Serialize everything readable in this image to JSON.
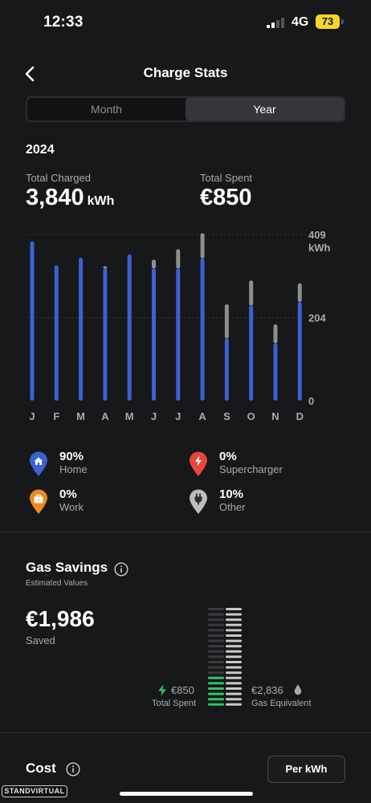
{
  "status_bar": {
    "time": "12:33",
    "network": "4G",
    "battery": "73"
  },
  "header": {
    "title": "Charge Stats"
  },
  "tabs": [
    {
      "label": "Month",
      "active": false
    },
    {
      "label": "Year",
      "active": true
    }
  ],
  "summary": {
    "year": "2024",
    "total_charged_label": "Total Charged",
    "total_charged_value": "3,840",
    "total_charged_unit": "kWh",
    "total_spent_label": "Total Spent",
    "total_spent_value": "€850"
  },
  "chart_data": {
    "type": "bar",
    "stacked": true,
    "categories": [
      "J",
      "F",
      "M",
      "A",
      "M",
      "J",
      "J",
      "A",
      "S",
      "O",
      "N",
      "D"
    ],
    "series": [
      {
        "name": "Home",
        "color": "#3a62d6",
        "values": [
          392,
          333,
          352,
          325,
          360,
          325,
          325,
          350,
          153,
          234,
          141,
          243
        ]
      },
      {
        "name": "Other",
        "color": "#8d8e90",
        "values": [
          0,
          0,
          0,
          6,
          0,
          22,
          48,
          62,
          84,
          62,
          47,
          46
        ]
      }
    ],
    "y_ticks": [
      "0",
      "204",
      "409"
    ],
    "y_unit": "kWh",
    "ylim": [
      0,
      409
    ],
    "grid": true
  },
  "legend": [
    {
      "pct": "90%",
      "name": "Home",
      "color": "#3a62d6",
      "icon": "home-icon"
    },
    {
      "pct": "0%",
      "name": "Supercharger",
      "color": "#e8463a",
      "icon": "bolt-icon"
    },
    {
      "pct": "0%",
      "name": "Work",
      "color": "#f08a1c",
      "icon": "briefcase-icon"
    },
    {
      "pct": "10%",
      "name": "Other",
      "color": "#bcbdbf",
      "icon": "plug-icon"
    }
  ],
  "gas_savings": {
    "title": "Gas Savings",
    "subtitle": "Estimated Values",
    "saved_value": "€1,986",
    "saved_label": "Saved",
    "total_spent_value": "€850",
    "total_spent_label": "Total Spent",
    "gas_equivalent_value": "€2,836",
    "gas_equivalent_label": "Gas Equivalent",
    "spent_amount": 850,
    "gas_amount": 2836,
    "colors": {
      "electric": "#2fc46a",
      "gas": "#c9c9cb"
    }
  },
  "cost": {
    "title": "Cost",
    "subtitle": "",
    "per_kwh_label": "Per kWh"
  },
  "watermark": "STANDVIRTUAL"
}
